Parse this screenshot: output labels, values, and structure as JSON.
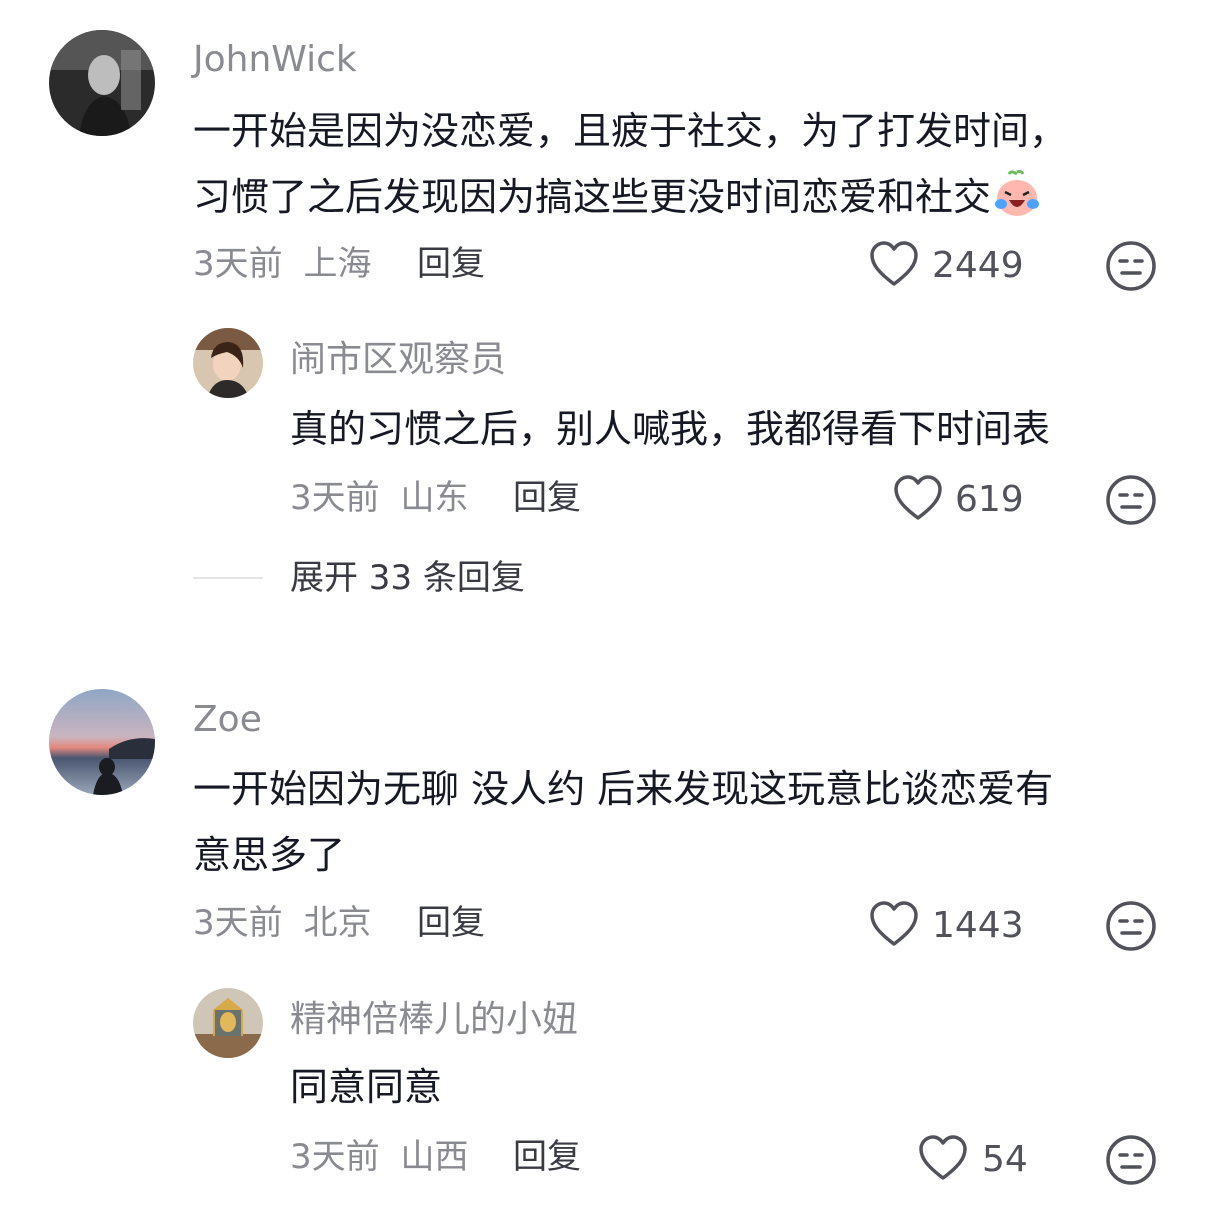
{
  "comments": [
    {
      "username": "JohnWick",
      "text_line1": "一开始是因为没恋爱，且疲于社交，为了打发时间，",
      "text_line2": "习惯了之后发现因为搞这些更没时间恋爱和社交",
      "emoji_icon": "crying-laughing-face-icon",
      "time": "3天前",
      "location": "上海",
      "reply_label": "回复",
      "likes": "2449",
      "replies": [
        {
          "username": "闹市区观察员",
          "text": "真的习惯之后，别人喊我，我都得看下时间表",
          "time": "3天前",
          "location": "山东",
          "reply_label": "回复",
          "likes": "619"
        }
      ],
      "expand_label": "展开 33 条回复"
    },
    {
      "username": "Zoe",
      "text_line1": "一开始因为无聊 没人约 后来发现这玩意比谈恋爱有",
      "text_line2": "意思多了",
      "time": "3天前",
      "location": "北京",
      "reply_label": "回复",
      "likes": "1443",
      "replies": [
        {
          "username": "精神倍棒儿的小妞",
          "text": "同意同意",
          "time": "3天前",
          "location": "山西",
          "reply_label": "回复",
          "likes": "54"
        }
      ]
    }
  ],
  "colors": {
    "text_primary": "#161823",
    "text_secondary": "#8a8b91",
    "icon_stroke": "#51525a"
  }
}
